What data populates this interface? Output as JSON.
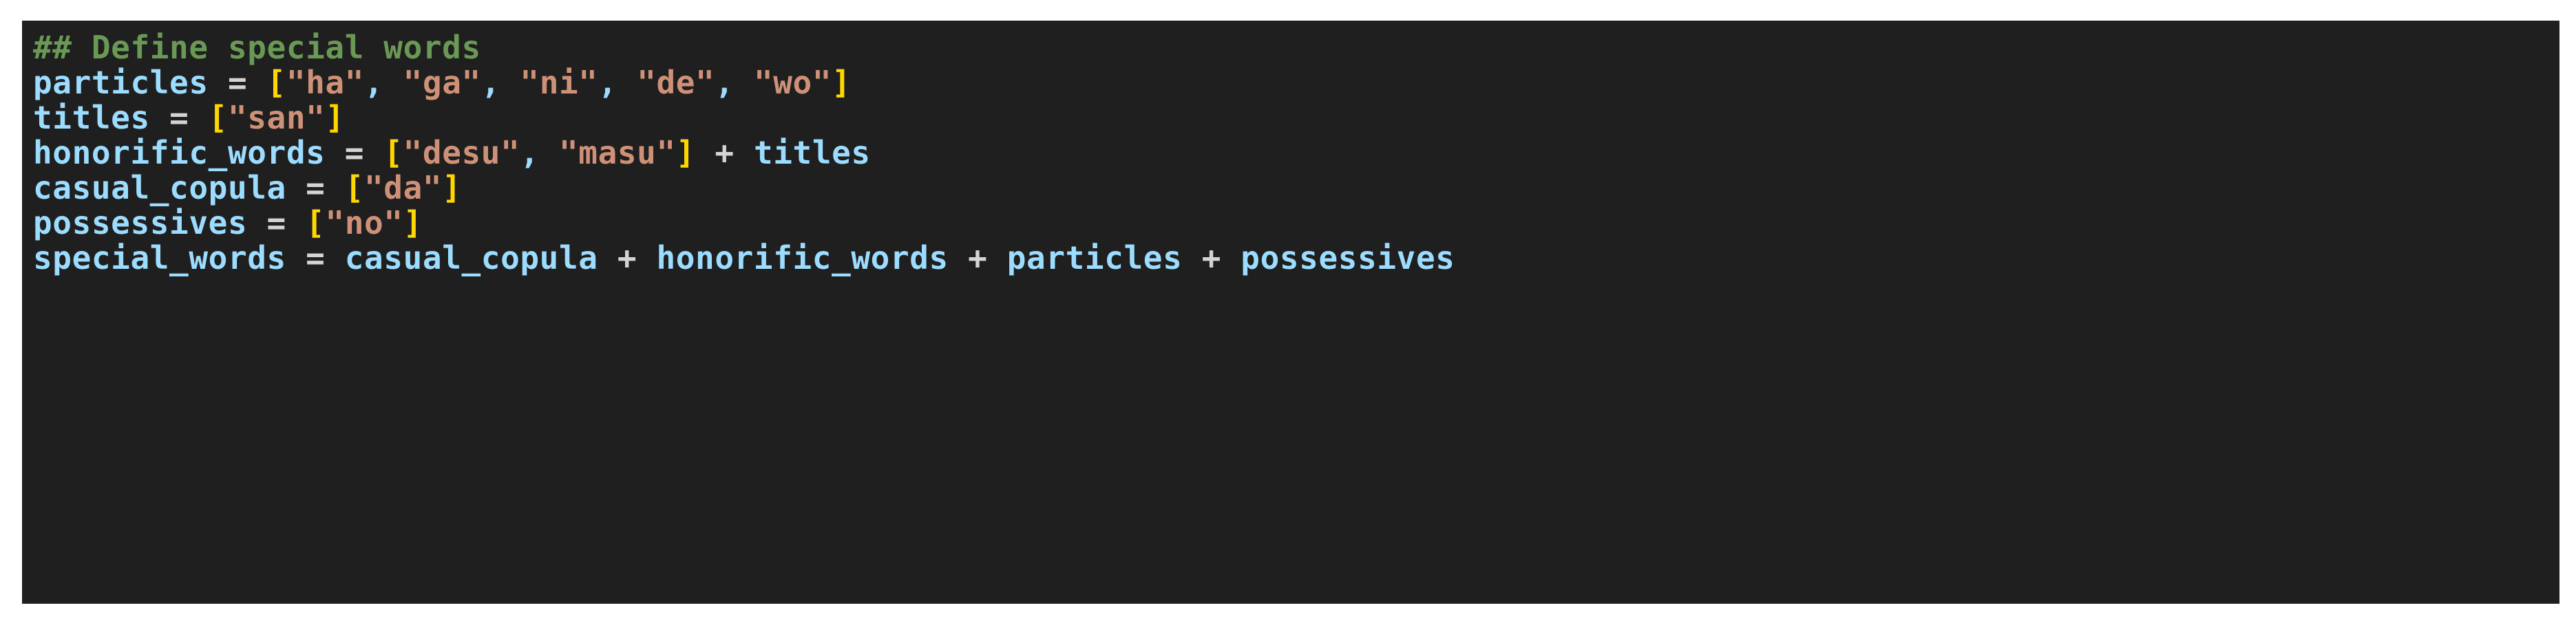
{
  "editor": {
    "background_color": "#1f1f1f",
    "page_background_color": "#ffffff",
    "language": "python",
    "colors": {
      "comment": "#6a9955",
      "variable": "#9cdcfe",
      "string": "#ce9178",
      "bracket": "#ffd700",
      "operator": "#d4d4d4",
      "punctuation": "#9cdcfe"
    }
  },
  "code": {
    "lines": [
      {
        "index": 0,
        "text": "## Define special words",
        "tokens": [
          {
            "t": "## Define special words",
            "k": "comment"
          }
        ]
      },
      {
        "index": 1,
        "text": "particles = [\"ha\", \"ga\", \"ni\", \"de\", \"wo\"]",
        "tokens": [
          {
            "t": "particles",
            "k": "var"
          },
          {
            "t": " ",
            "k": "plain"
          },
          {
            "t": "=",
            "k": "op"
          },
          {
            "t": " ",
            "k": "plain"
          },
          {
            "t": "[",
            "k": "bracket"
          },
          {
            "t": "\"ha\"",
            "k": "string"
          },
          {
            "t": ",",
            "k": "punct"
          },
          {
            "t": " ",
            "k": "plain"
          },
          {
            "t": "\"ga\"",
            "k": "string"
          },
          {
            "t": ",",
            "k": "punct"
          },
          {
            "t": " ",
            "k": "plain"
          },
          {
            "t": "\"ni\"",
            "k": "string"
          },
          {
            "t": ",",
            "k": "punct"
          },
          {
            "t": " ",
            "k": "plain"
          },
          {
            "t": "\"de\"",
            "k": "string"
          },
          {
            "t": ",",
            "k": "punct"
          },
          {
            "t": " ",
            "k": "plain"
          },
          {
            "t": "\"wo\"",
            "k": "string"
          },
          {
            "t": "]",
            "k": "bracket"
          }
        ]
      },
      {
        "index": 2,
        "text": "titles = [\"san\"]",
        "tokens": [
          {
            "t": "titles",
            "k": "var"
          },
          {
            "t": " ",
            "k": "plain"
          },
          {
            "t": "=",
            "k": "op"
          },
          {
            "t": " ",
            "k": "plain"
          },
          {
            "t": "[",
            "k": "bracket"
          },
          {
            "t": "\"san\"",
            "k": "string"
          },
          {
            "t": "]",
            "k": "bracket"
          }
        ]
      },
      {
        "index": 3,
        "text": "honorific_words = [\"desu\", \"masu\"] + titles",
        "tokens": [
          {
            "t": "honorific_words",
            "k": "var"
          },
          {
            "t": " ",
            "k": "plain"
          },
          {
            "t": "=",
            "k": "op"
          },
          {
            "t": " ",
            "k": "plain"
          },
          {
            "t": "[",
            "k": "bracket"
          },
          {
            "t": "\"desu\"",
            "k": "string"
          },
          {
            "t": ",",
            "k": "punct"
          },
          {
            "t": " ",
            "k": "plain"
          },
          {
            "t": "\"masu\"",
            "k": "string"
          },
          {
            "t": "]",
            "k": "bracket"
          },
          {
            "t": " ",
            "k": "plain"
          },
          {
            "t": "+",
            "k": "op"
          },
          {
            "t": " ",
            "k": "plain"
          },
          {
            "t": "titles",
            "k": "var"
          }
        ]
      },
      {
        "index": 4,
        "text": "casual_copula = [\"da\"]",
        "tokens": [
          {
            "t": "casual_copula",
            "k": "var"
          },
          {
            "t": " ",
            "k": "plain"
          },
          {
            "t": "=",
            "k": "op"
          },
          {
            "t": " ",
            "k": "plain"
          },
          {
            "t": "[",
            "k": "bracket"
          },
          {
            "t": "\"da\"",
            "k": "string"
          },
          {
            "t": "]",
            "k": "bracket"
          }
        ]
      },
      {
        "index": 5,
        "text": "possessives = [\"no\"]",
        "tokens": [
          {
            "t": "possessives",
            "k": "var"
          },
          {
            "t": " ",
            "k": "plain"
          },
          {
            "t": "=",
            "k": "op"
          },
          {
            "t": " ",
            "k": "plain"
          },
          {
            "t": "[",
            "k": "bracket"
          },
          {
            "t": "\"no\"",
            "k": "string"
          },
          {
            "t": "]",
            "k": "bracket"
          }
        ]
      },
      {
        "index": 6,
        "text": "special_words = casual_copula + honorific_words + particles + possessives",
        "tokens": [
          {
            "t": "special_words",
            "k": "var"
          },
          {
            "t": " ",
            "k": "plain"
          },
          {
            "t": "=",
            "k": "op"
          },
          {
            "t": " ",
            "k": "plain"
          },
          {
            "t": "casual_copula",
            "k": "var"
          },
          {
            "t": " ",
            "k": "plain"
          },
          {
            "t": "+",
            "k": "op"
          },
          {
            "t": " ",
            "k": "plain"
          },
          {
            "t": "honorific_words",
            "k": "var"
          },
          {
            "t": " ",
            "k": "plain"
          },
          {
            "t": "+",
            "k": "op"
          },
          {
            "t": " ",
            "k": "plain"
          },
          {
            "t": "particles",
            "k": "var"
          },
          {
            "t": " ",
            "k": "plain"
          },
          {
            "t": "+",
            "k": "op"
          },
          {
            "t": " ",
            "k": "plain"
          },
          {
            "t": "possessives",
            "k": "var"
          }
        ]
      }
    ]
  }
}
